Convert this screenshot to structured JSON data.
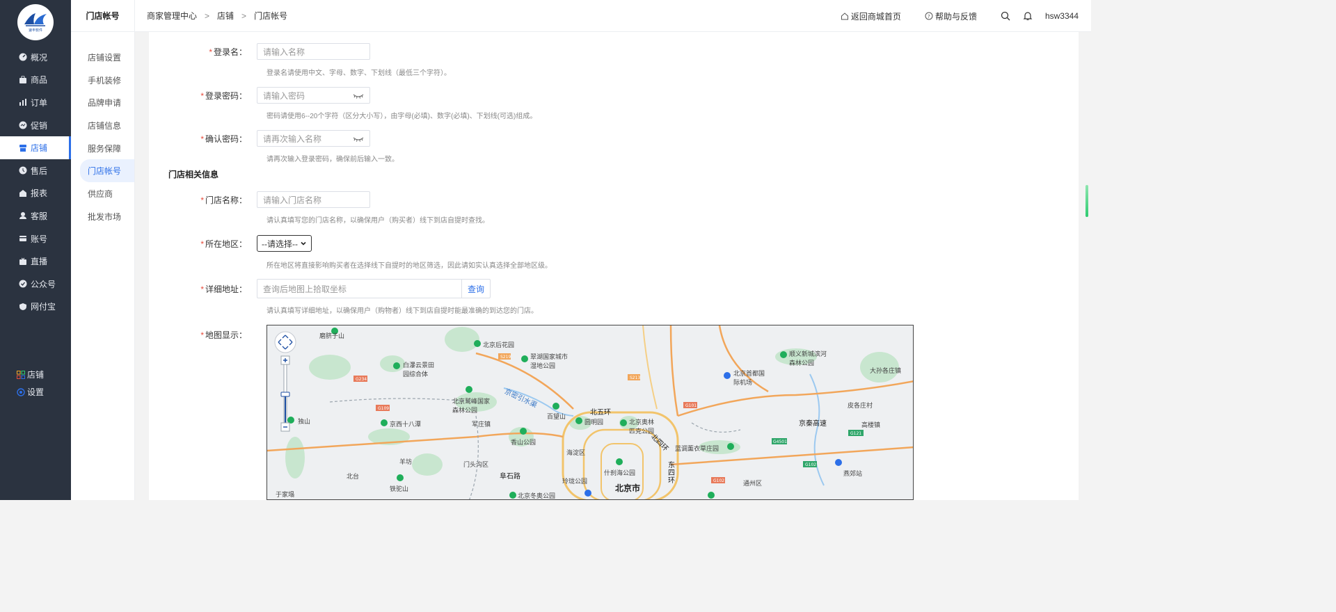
{
  "brand": {
    "logo_text": "速丰软件"
  },
  "main_nav": [
    {
      "label": "概况",
      "icon": "dashboard-icon"
    },
    {
      "label": "商品",
      "icon": "bag-icon"
    },
    {
      "label": "订单",
      "icon": "chart-icon"
    },
    {
      "label": "促销",
      "icon": "promotion-icon"
    },
    {
      "label": "店铺",
      "icon": "store-icon",
      "active": true
    },
    {
      "label": "售后",
      "icon": "service-icon"
    },
    {
      "label": "报表",
      "icon": "report-icon"
    },
    {
      "label": "客服",
      "icon": "support-icon"
    },
    {
      "label": "账号",
      "icon": "card-icon"
    },
    {
      "label": "直播",
      "icon": "live-icon"
    },
    {
      "label": "公众号",
      "icon": "shield-check-icon"
    },
    {
      "label": "网付宝",
      "icon": "shield-icon"
    }
  ],
  "bottom_nav": [
    {
      "label": "店铺",
      "icon": "grid-icon"
    },
    {
      "label": "设置",
      "icon": "settings-icon"
    }
  ],
  "subnav": {
    "title": "门店帐号",
    "items": [
      "店铺设置",
      "手机装修",
      "品牌申请",
      "店铺信息",
      "服务保障",
      "门店帐号",
      "供应商",
      "批发市场"
    ],
    "active_index": 5
  },
  "breadcrumb": [
    "商家管理中心",
    "店铺",
    "门店帐号"
  ],
  "breadcrumb_sep": ">",
  "top_actions": {
    "home": "返回商城首页",
    "help": "帮助与反馈",
    "user": "hsw3344"
  },
  "form": {
    "required_mark": "*",
    "login_name": {
      "label": "登录名：",
      "placeholder": "请输入名称",
      "hint": "登录名请使用中文、字母、数字、下划线（最低三个字符）。"
    },
    "password": {
      "label": "登录密码：",
      "placeholder": "请输入密码",
      "hint": "密码请使用6--20个字符（区分大小写），由字母(必填)、数字(必填)、下划线(可选)组成。"
    },
    "confirm_password": {
      "label": "确认密码：",
      "placeholder": "请再次输入名称",
      "hint": "请再次输入登录密码，确保前后输入一致。"
    },
    "section_title": "门店相关信息",
    "store_name": {
      "label": "门店名称：",
      "placeholder": "请输入门店名称",
      "hint": "请认真填写您的门店名称，以确保用户（购买者）线下到店自提时查找。"
    },
    "region": {
      "label": "所在地区：",
      "selected": "--请选择--",
      "hint": "所在地区将直接影响购买者在选择线下自提时的地区筛选，因此请如实认真选择全部地区级。"
    },
    "address": {
      "label": "详细地址：",
      "placeholder": "查询后地图上拾取坐标",
      "button": "查询",
      "hint": "请认真填写详细地址，以确保用户（购物者）线下到店自提时能最准确的到达您的门店。"
    },
    "map": {
      "label": "地图显示："
    }
  },
  "map_labels": {
    "big": [
      "北京市"
    ],
    "med": [
      "北五环",
      "北四环",
      "东四环",
      "京秦高速",
      "京密引水渠",
      "阜石路"
    ],
    "small": [
      "磨脐子山",
      "北京后花园",
      "翠湖国家城市湿地公园",
      "白瀑云景田园综合体",
      "北京鹫峰国家森林公园",
      "百望山",
      "圆明园",
      "北京奥林匹克公园",
      "北京首都国际机场",
      "顺义新城滨河森林公园",
      "大孙各庄镇",
      "皮各庄村",
      "高楼镇",
      "独山",
      "京西十八潭",
      "军庄镇",
      "香山公园",
      "海淀区",
      "蓝调薰衣草庄园",
      "门头沟区",
      "羊坊",
      "北台",
      "铁驼山",
      "玲珑公园",
      "什刹海公园",
      "通州区",
      "燕郊站",
      "北京冬奥公园",
      "于家塌"
    ]
  },
  "colors": {
    "accent": "#2c6fe8",
    "sidebar_bg": "#2b3340",
    "required": "#e74c3c"
  }
}
